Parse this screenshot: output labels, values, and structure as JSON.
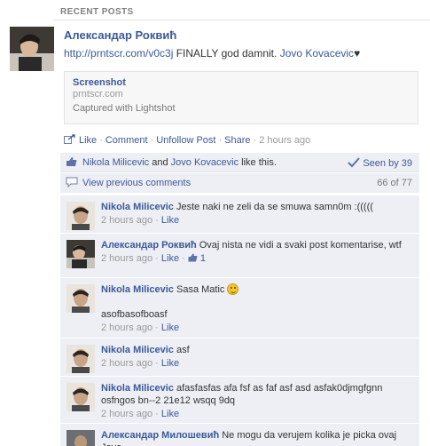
{
  "section": {
    "title": "RECENT POSTS"
  },
  "post": {
    "author": "Александар Роквић",
    "link_text": "http://prntscr.com/v0c3j",
    "message": " FINALLY god damnit. ",
    "tagged": "Jovo Kovacevic",
    "heart": "♥",
    "attachment": {
      "title": "Screenshot",
      "domain": "prntscr.com",
      "caption": "Captured with Lightshot"
    },
    "actions": {
      "like": "Like",
      "comment": "Comment",
      "unfollow": "Unfollow Post",
      "share": "Share",
      "time": "2 hours ago"
    }
  },
  "likes": {
    "user1": "Nikola Milicevic",
    "and": " and ",
    "user2": "Jovo Kovacevic",
    "suffix": " like this.",
    "seen": "Seen by 39"
  },
  "previous": {
    "label": "View previous comments",
    "count": "66 of 77"
  },
  "comments": [
    {
      "name": "Nikola Milicevic",
      "text": "Jeste naki ne zeli da se smuwa samn0m :(((((",
      "time": "2 hours ago",
      "like": "Like"
    },
    {
      "name": "Александар Роквић",
      "text": "Ovaj nista ne vidi a svaki post komentarise, wtf",
      "time": "2 hours ago",
      "like": "Like",
      "likes_count": "1"
    },
    {
      "name": "Nikola Milicevic",
      "text": "Sasa Matic",
      "text2": "asofbasofboasf",
      "time": "2 hours ago",
      "like": "Like"
    },
    {
      "name": "Nikola Milicevic",
      "text": "asf",
      "time": "2 hours ago",
      "like": "Like"
    },
    {
      "name": "Nikola Milicevic",
      "text": "afasfasfas afa fsf as faf asf asd asfak0djmgfgnn osfngos bn--2 21e12 wsqq 9dq",
      "time": "2 hours ago",
      "like": "Like"
    },
    {
      "name": "Александар Милошевић",
      "text": "Ne mogu da verujem kolika je picka ovaj Jovo"
    }
  ]
}
